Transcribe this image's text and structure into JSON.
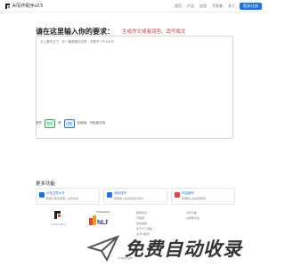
{
  "navbar": {
    "brand": "AI写作助手v2.5",
    "links": [
      "首页",
      "产品",
      "应用",
      "开发者",
      "关于"
    ],
    "login_label": "登录/注册"
  },
  "heading": {
    "text": "请在这里输入你的要求：",
    "hint": "生成作文或者润色、改写成文"
  },
  "editor": {
    "value": "马上要毕业了，写一篇想象的文章，字数不少于100字"
  },
  "controls": {
    "prefix": "请先",
    "btn1": "登录",
    "middle": "或",
    "btn2": "注册",
    "suffix": "后使用，可免费试用"
  },
  "features": {
    "section_title": "更多功能",
    "items": [
      {
        "title": "AI写文章大手",
        "desc": "根据人类的需要，生成文章",
        "icon": "ai-writer-icon",
        "color": "#1a73e8"
      },
      {
        "title": "润色改写",
        "desc": "根据输入的内容进行润色",
        "icon": "polish-icon",
        "color": "#2b6ef0"
      },
      {
        "title": "内容缩写",
        "desc": "根据输入的内容精简",
        "icon": "condense-icon",
        "color": "#e0483d"
      }
    ]
  },
  "footer": {
    "copy": "© 2021-2023",
    "powered_by": "Powered by",
    "col1": [
      "服务协议",
      "开发者",
      "隐私政策",
      "关于小丁网络",
      "关于AI助手"
    ],
    "col2": [
      "AI写文章",
      "AI润色平台"
    ]
  },
  "bottom": {
    "copyright": "Copyright",
    "watermark": "免费自动收录"
  }
}
